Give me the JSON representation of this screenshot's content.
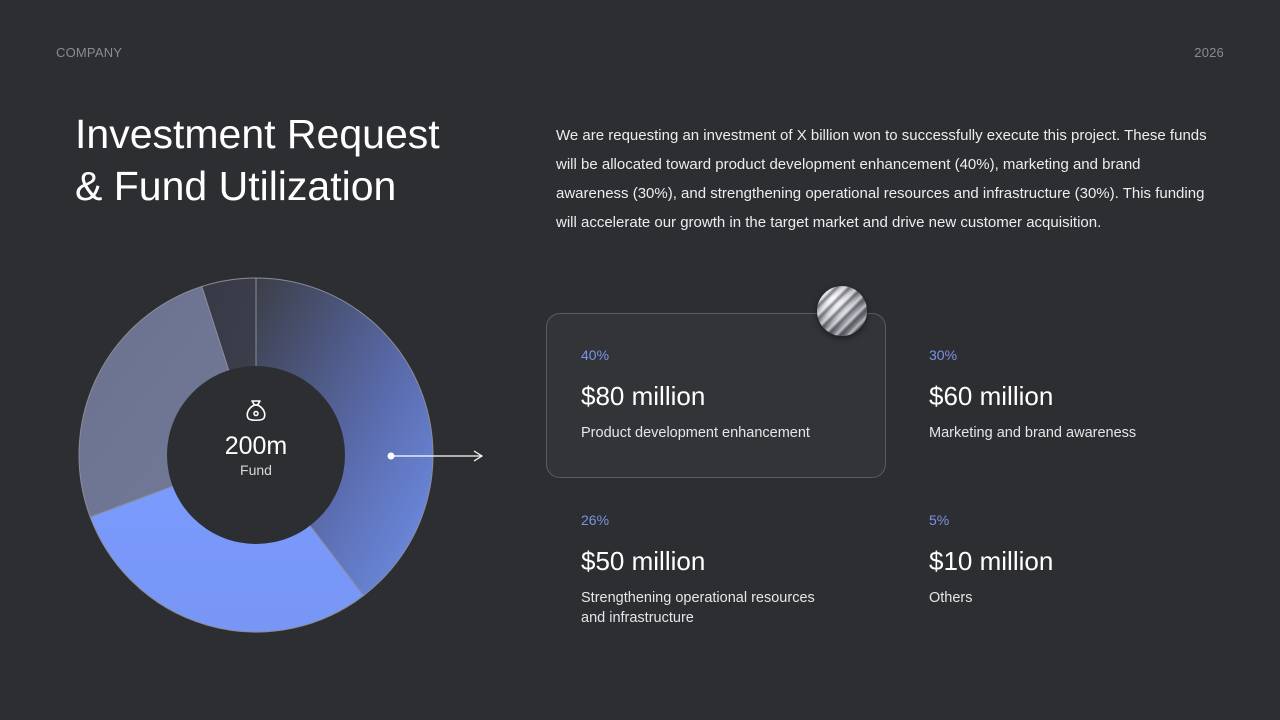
{
  "header": {
    "left": "COMPANY",
    "right": "2026"
  },
  "title": {
    "line1": "Investment Request",
    "line2": "& Fund Utilization"
  },
  "description": "We are requesting an investment of X billion won to successfully execute this project. These funds will be allocated toward product development enhancement (40%), marketing and brand awareness (30%), and strengthening operational resources and infrastructure (30%). This funding will accelerate our growth in the target market and drive new customer acquisition.",
  "center": {
    "value": "200m",
    "label": "Fund",
    "icon": "money-bag-icon"
  },
  "items": [
    {
      "pct": "40%",
      "amount": "$80 million",
      "desc": "Product development enhancement"
    },
    {
      "pct": "30%",
      "amount": "$60 million",
      "desc": "Marketing and brand awareness"
    },
    {
      "pct": "26%",
      "amount": "$50 million",
      "desc": "Strengthening operational resources and infrastructure"
    },
    {
      "pct": "5%",
      "amount": "$10 million",
      "desc": "Others"
    }
  ],
  "colors": {
    "background": "#2d2e32",
    "accent": "#7b93e6",
    "slice_1": "#6f86d6",
    "slice_2": "#7c9cff",
    "slice_3": "#6d7592",
    "slice_4": "#3a3d4a"
  },
  "chart_data": {
    "type": "pie",
    "donut": true,
    "categories": [
      "Product development enhancement",
      "Marketing and brand awareness",
      "Strengthening operational resources and infrastructure",
      "Others"
    ],
    "values": [
      40,
      30,
      26,
      5
    ],
    "center_text": "200m",
    "center_subtext": "Fund"
  }
}
